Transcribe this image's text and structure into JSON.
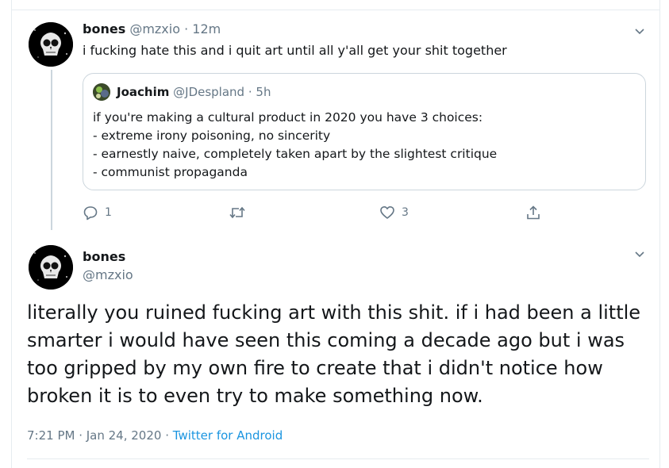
{
  "colors": {
    "text": "#14171a",
    "muted": "#657786",
    "link": "#1b95e0",
    "border": "#ccd6dd"
  },
  "reply_tweet": {
    "author_name": "bones",
    "author_handle": "@mzxio",
    "separator": "·",
    "time_ago": "12m",
    "text": "i fucking hate this and i quit art until all y'all get your shit together",
    "avatar_icon": "skull-avatar-icon",
    "menu_icon": "chevron-down-icon",
    "quoted": {
      "author_name": "Joachim",
      "author_handle": "@JDespland",
      "separator": "·",
      "time_ago": "5h",
      "avatar_icon": "profile-avatar-icon",
      "lines": [
        "if you're making a cultural product in 2020 you have 3 choices:",
        "- extreme irony poisoning, no sincerity",
        "- earnestly naive, completely taken apart by the slightest critique",
        "- communist propaganda"
      ]
    },
    "actions": {
      "reply_count": "1",
      "retweet_count": "",
      "like_count": "3",
      "reply_icon": "reply-icon",
      "retweet_icon": "retweet-icon",
      "like_icon": "heart-icon",
      "share_icon": "share-icon"
    }
  },
  "main_tweet": {
    "author_name": "bones",
    "author_handle": "@mzxio",
    "avatar_icon": "skull-avatar-icon",
    "menu_icon": "chevron-down-icon",
    "lines": [
      "literally you ruined fucking art with this shit. if i had been a little",
      "smarter i would have seen this coming a decade ago but i was",
      "too gripped by my own fire to create that i didn't notice how",
      "broken it is to even try to make something now."
    ],
    "timestamp": "7:21 PM · Jan 24, 2020",
    "meta_separator": "·",
    "source": "Twitter for Android"
  }
}
